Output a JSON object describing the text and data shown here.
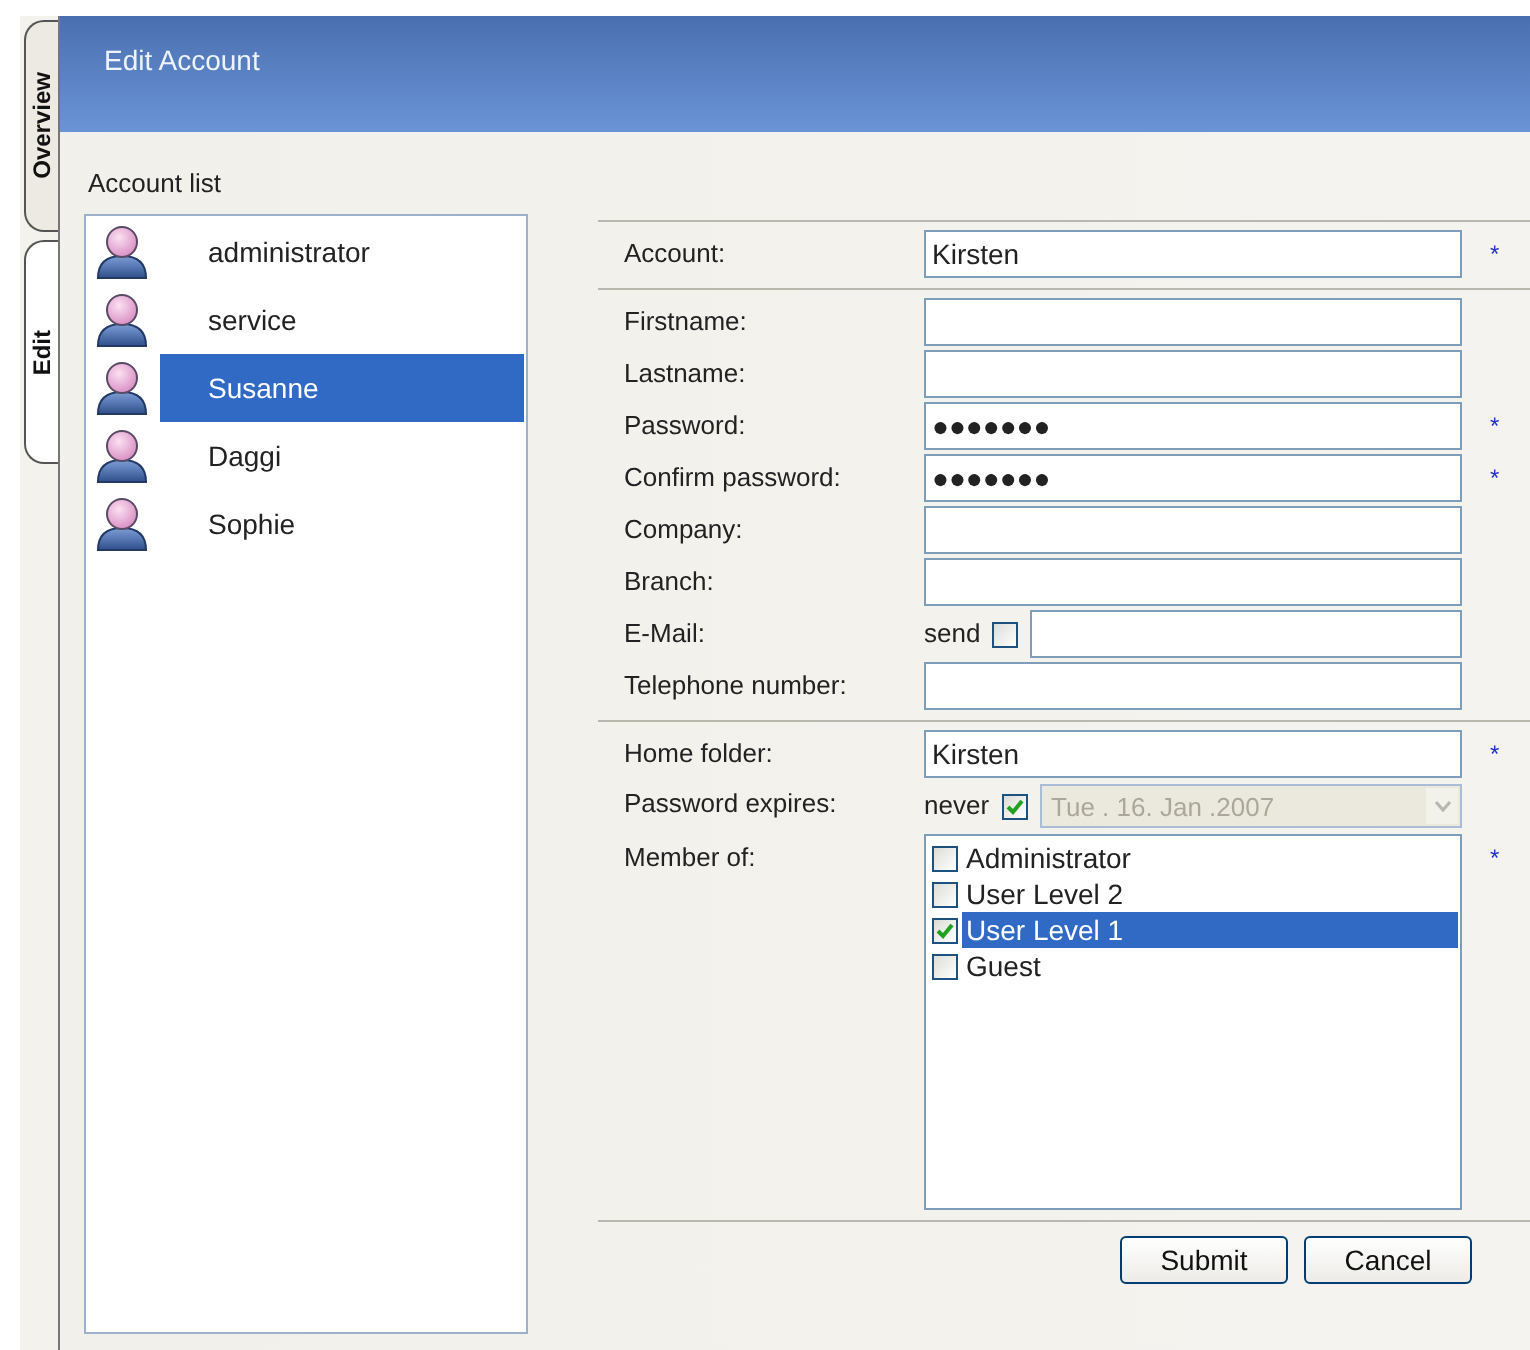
{
  "side_tabs": [
    {
      "label": "Overview",
      "selected": false
    },
    {
      "label": "Edit",
      "selected": true
    }
  ],
  "header": {
    "title": "Edit Account"
  },
  "account_list": {
    "label": "Account list",
    "items": [
      {
        "name": "administrator",
        "selected": false
      },
      {
        "name": "service",
        "selected": false
      },
      {
        "name": "Susanne",
        "selected": true
      },
      {
        "name": "Daggi",
        "selected": false
      },
      {
        "name": "Sophie",
        "selected": false
      }
    ]
  },
  "sections": [
    {
      "rows": [
        {
          "kind": "text",
          "label": "Account:",
          "value": "Kirsten",
          "required_mark": "*"
        }
      ]
    },
    {
      "rows": [
        {
          "kind": "text",
          "label": "Firstname:"
        },
        {
          "kind": "text",
          "label": "Lastname:"
        },
        {
          "kind": "text",
          "label": "Password:",
          "value": "●●●●●●●",
          "required_mark": "*"
        },
        {
          "kind": "text",
          "label": "Confirm password:",
          "value": "●●●●●●●",
          "required_mark": "*"
        },
        {
          "kind": "text",
          "label": "Company:"
        },
        {
          "kind": "text",
          "label": "Branch:"
        },
        {
          "kind": "email",
          "label": "E-Mail:",
          "option_label": "send",
          "checked": false
        },
        {
          "kind": "text",
          "label": "Telephone number:"
        }
      ]
    },
    {
      "rows": [
        {
          "kind": "text",
          "label": "Home folder:",
          "value": "Kirsten",
          "required_mark": "*"
        },
        {
          "kind": "date",
          "label": "Password expires:",
          "option_label": "never",
          "checked": true,
          "value": "Tue . 16. Jan .2007",
          "disabled": true
        },
        {
          "kind": "groups",
          "label": "Member of:",
          "required_mark": "*",
          "items": [
            {
              "name": "Administrator",
              "checked": false,
              "selected": false
            },
            {
              "name": "User Level 2",
              "checked": false,
              "selected": false
            },
            {
              "name": "User Level 1",
              "checked": true,
              "selected": true
            },
            {
              "name": "Guest",
              "checked": false,
              "selected": false
            }
          ]
        }
      ]
    }
  ],
  "buttons": [
    {
      "label": "Submit"
    },
    {
      "label": "Cancel"
    }
  ]
}
